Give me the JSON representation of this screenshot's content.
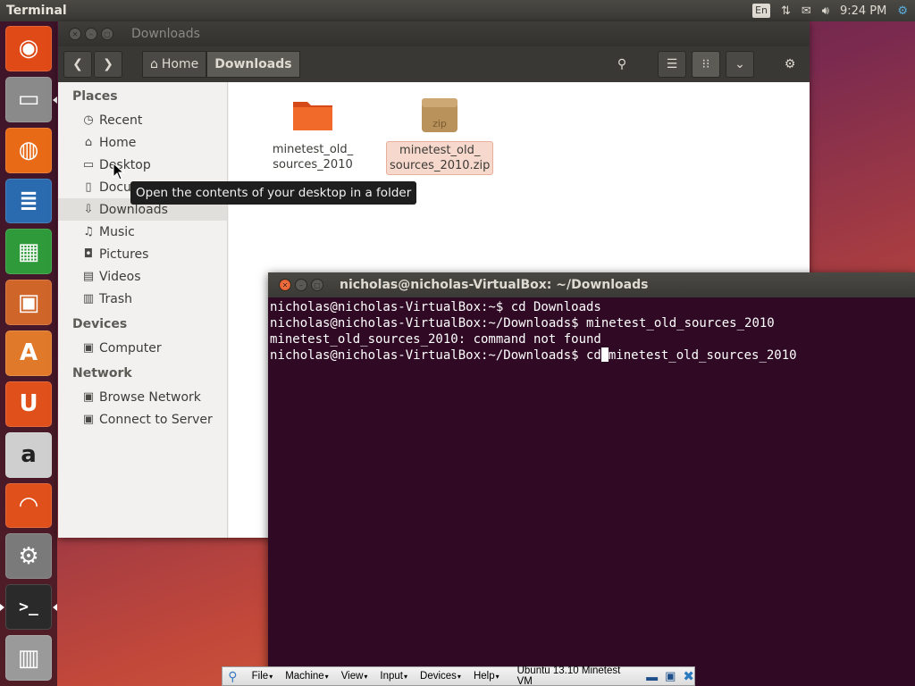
{
  "top_panel": {
    "app_title": "Terminal",
    "keyboard_layout": "En",
    "clock": "9:24 PM",
    "icons": [
      "network-icon",
      "mail-icon",
      "volume-icon",
      "settings-gear-icon"
    ]
  },
  "launcher": {
    "items": [
      {
        "name": "dash-home",
        "glyph": "◉",
        "color": "#df4a16"
      },
      {
        "name": "files",
        "glyph": "▭",
        "color": "#8a8a8a"
      },
      {
        "name": "firefox",
        "glyph": "◍",
        "color": "#e86a17"
      },
      {
        "name": "libreoffice-writer",
        "glyph": "≣",
        "color": "#2a6bb0"
      },
      {
        "name": "libreoffice-calc",
        "glyph": "▦",
        "color": "#2e9a3a"
      },
      {
        "name": "libreoffice-impress",
        "glyph": "▣",
        "color": "#d0652a"
      },
      {
        "name": "software-center",
        "glyph": "A",
        "color": "#e07a2a"
      },
      {
        "name": "ubuntu-one",
        "glyph": "U",
        "color": "#e0501a"
      },
      {
        "name": "amazon",
        "glyph": "a",
        "color": "#cfcfcf"
      },
      {
        "name": "ubuntu-one-music",
        "glyph": "◠",
        "color": "#e0501a"
      },
      {
        "name": "system-settings",
        "glyph": "⚙",
        "color": "#7a7a7a"
      },
      {
        "name": "terminal",
        "glyph": ">_",
        "color": "#2a2a2a"
      },
      {
        "name": "trash",
        "glyph": "▥",
        "color": "#9a9a9a"
      }
    ]
  },
  "file_manager": {
    "window_title": "Downloads",
    "breadcrumbs": [
      "Home",
      "Downloads"
    ],
    "sidebar": {
      "places_header": "Places",
      "places": [
        {
          "label": "Recent",
          "icon": "◷"
        },
        {
          "label": "Home",
          "icon": "⌂"
        },
        {
          "label": "Desktop",
          "icon": "▭"
        },
        {
          "label": "Docu",
          "icon": "▯"
        },
        {
          "label": "Downloads",
          "icon": "⇩"
        },
        {
          "label": "Music",
          "icon": "♫"
        },
        {
          "label": "Pictures",
          "icon": "◘"
        },
        {
          "label": "Videos",
          "icon": "▤"
        },
        {
          "label": "Trash",
          "icon": "▥"
        }
      ],
      "devices_header": "Devices",
      "devices": [
        {
          "label": "Computer",
          "icon": "▣"
        }
      ],
      "network_header": "Network",
      "network": [
        {
          "label": "Browse Network",
          "icon": "▣"
        },
        {
          "label": "Connect to Server",
          "icon": "▣"
        }
      ]
    },
    "files": [
      {
        "line1": "minetest_old_",
        "line2": "sources_2010",
        "type": "folder"
      },
      {
        "line1": "minetest_old_",
        "line2": "sources_2010.zip",
        "type": "zip",
        "icon_text": "zip"
      }
    ],
    "tooltip": "Open the contents of your desktop in a folder"
  },
  "terminal": {
    "title": "nicholas@nicholas-VirtualBox: ~/Downloads",
    "lines": [
      "nicholas@nicholas-VirtualBox:~$ cd Downloads",
      "nicholas@nicholas-VirtualBox:~/Downloads$ minetest_old_sources_2010",
      "minetest_old_sources_2010: command not found"
    ],
    "current_prompt": "nicholas@nicholas-VirtualBox:~/Downloads$ cd",
    "current_after_cursor": "minetest_old_sources_2010"
  },
  "vbox_bar": {
    "menus": [
      "File",
      "Machine",
      "View",
      "Input",
      "Devices",
      "Help"
    ],
    "vm_name": "Ubuntu 13.10 Minetest VM"
  }
}
